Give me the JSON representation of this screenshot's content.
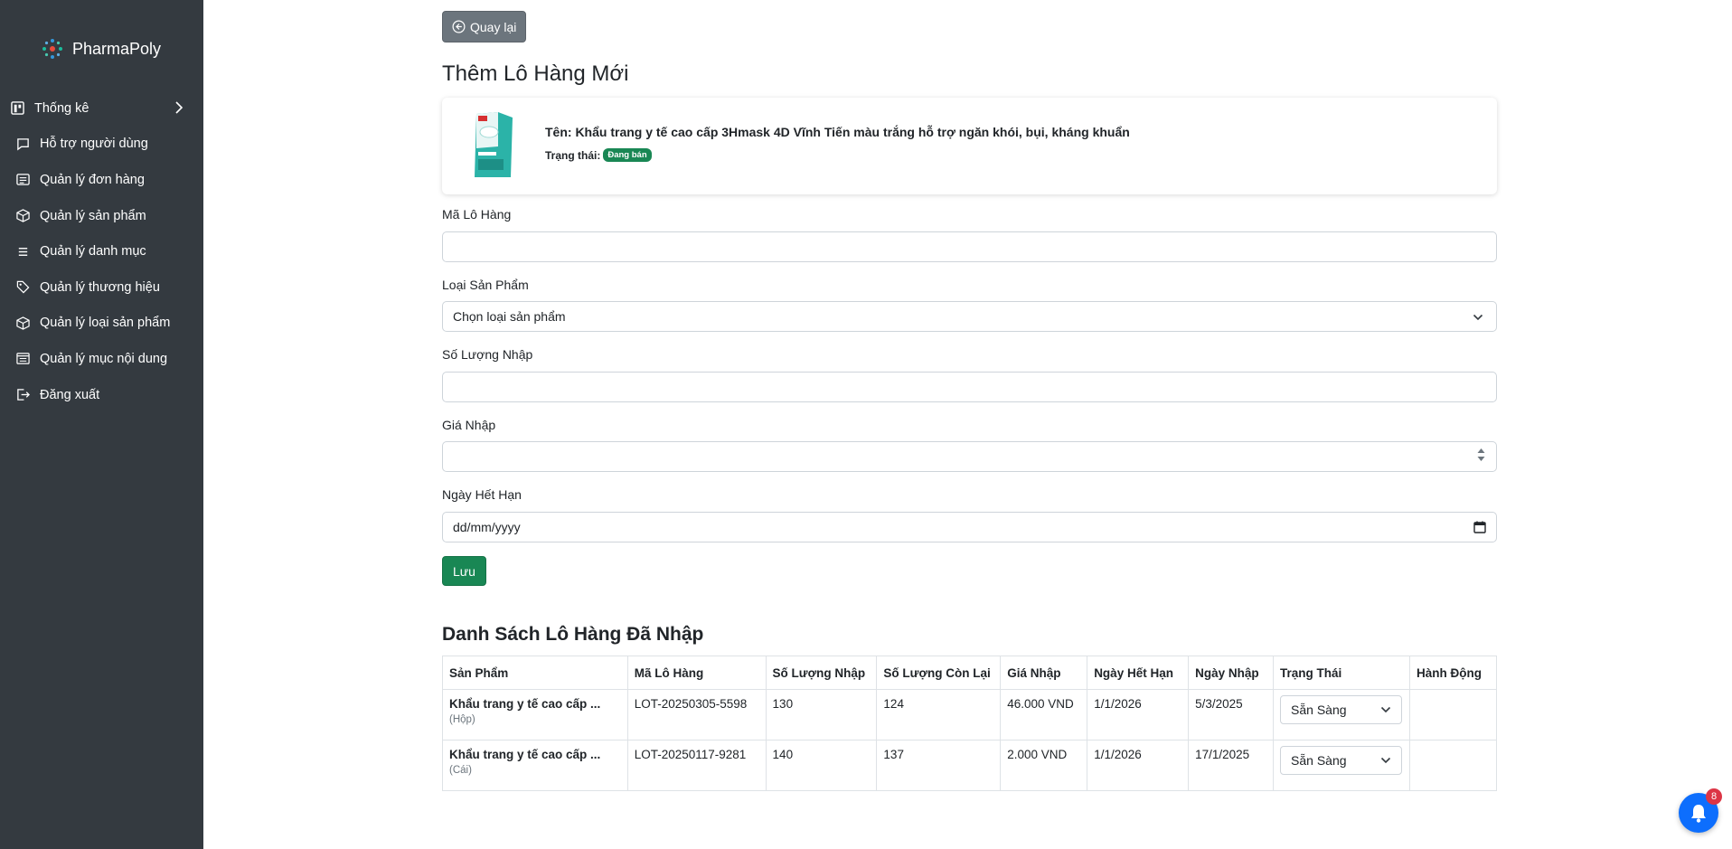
{
  "sidebar": {
    "brand": "PharmaPoly",
    "items": [
      {
        "label": "Thống kê",
        "icon": "chart-icon"
      },
      {
        "label": "Hỗ trợ người dùng",
        "icon": "chat-icon"
      },
      {
        "label": "Quản lý đơn hàng",
        "icon": "orders-icon"
      },
      {
        "label": "Quản lý sản phẩm",
        "icon": "box-icon"
      },
      {
        "label": "Quản lý danh mục",
        "icon": "list-icon"
      },
      {
        "label": "Quản lý thương hiệu",
        "icon": "tag-icon"
      },
      {
        "label": "Quản lý loại sản phẩm",
        "icon": "box-icon"
      },
      {
        "label": "Quản lý mục nội dung",
        "icon": "content-icon"
      },
      {
        "label": "Đăng xuất",
        "icon": "logout-icon"
      }
    ]
  },
  "main": {
    "back_label": "Quay lại",
    "title": "Thêm Lô Hàng Mới",
    "product": {
      "name": "Tên: Khẩu trang y tế cao cấp 3Hmask 4D Vĩnh Tiến màu trắng hỗ trợ ngăn khói, bụi, kháng khuẩn",
      "status_label": "Trạng thái:",
      "status_badge": "Đang bán"
    },
    "form": {
      "lot_code_label": "Mã Lô Hàng",
      "lot_code_value": "",
      "type_label": "Loại Sản Phẩm",
      "type_selected": "Chọn loại sản phẩm",
      "qty_label": "Số Lượng Nhập",
      "qty_value": "",
      "price_label": "Giá Nhập",
      "price_value": "",
      "expiry_label": "Ngày Hết Hạn",
      "expiry_placeholder": "dd/mm/yyyy",
      "save_label": "Lưu"
    },
    "list_title": "Danh Sách Lô Hàng Đã Nhập",
    "table": {
      "headers": [
        "Sản Phẩm",
        "Mã Lô Hàng",
        "Số Lượng Nhập",
        "Số Lượng Còn Lại",
        "Giá Nhập",
        "Ngày Hết Hạn",
        "Ngày Nhập",
        "Trạng Thái",
        "Hành Động"
      ],
      "rows": [
        {
          "product": "Khẩu trang y tế cao cấp ...",
          "unit": "(Hộp)",
          "lot": "LOT-20250305-5598",
          "qty_in": "130",
          "qty_left": "124",
          "price": "46.000 VND",
          "expiry": "1/1/2026",
          "import_date": "5/3/2025",
          "status": "Sẵn Sàng"
        },
        {
          "product": "Khẩu trang y tế cao cấp ...",
          "unit": "(Cái)",
          "lot": "LOT-20250117-9281",
          "qty_in": "140",
          "qty_left": "137",
          "price": "2.000 VND",
          "expiry": "1/1/2026",
          "import_date": "17/1/2025",
          "status": "Sẵn Sàng"
        }
      ]
    }
  },
  "notifications": {
    "count": "8"
  },
  "colors": {
    "sidebar": "#343a40",
    "success": "#198754",
    "secondary": "#6c757d",
    "primary": "#0d6efd",
    "danger": "#dc3545"
  }
}
